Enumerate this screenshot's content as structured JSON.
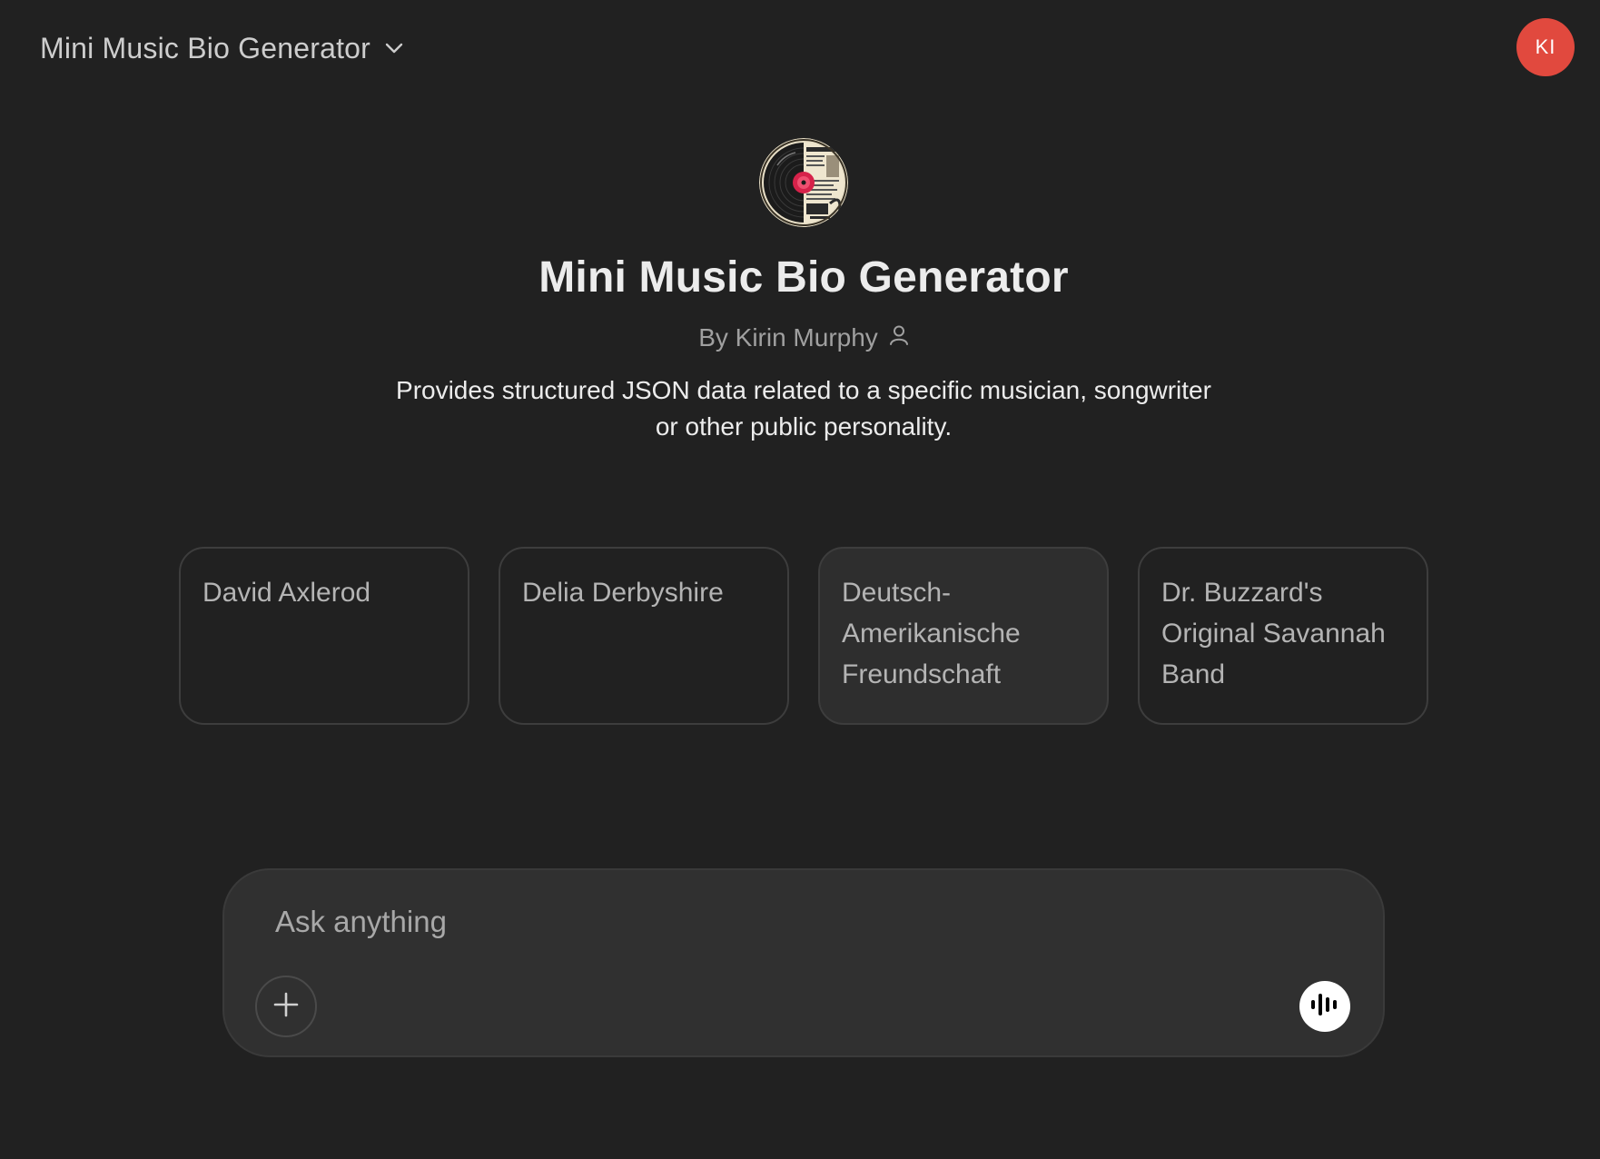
{
  "header": {
    "model_picker_label": "Mini Music Bio Generator",
    "chevron_icon": "chevron-down-icon",
    "avatar_initials": "KI",
    "avatar_color": "#e1493e"
  },
  "gpt": {
    "logo_icon": "vinyl-record-biography-logo",
    "title": "Mini Music Bio Generator",
    "byline": "By Kirin Murphy",
    "byline_icon": "person-icon",
    "description": "Provides structured JSON data related to a specific musician, songwriter or other public personality."
  },
  "starters": [
    {
      "label": "David Axlerod"
    },
    {
      "label": "Delia Derbyshire"
    },
    {
      "label": "Deutsch-Amerikanische Freundschaft"
    },
    {
      "label": "Dr. Buzzard's Original Savannah Band"
    }
  ],
  "composer": {
    "placeholder": "Ask anything",
    "value": "",
    "plus_icon": "plus-icon",
    "voice_icon": "voice-waveform-icon"
  },
  "colors": {
    "background": "#212121",
    "composer_background": "#303030",
    "card_border": "#3d3d3d",
    "text_primary": "#ececec",
    "text_secondary": "#a0a0a0"
  }
}
